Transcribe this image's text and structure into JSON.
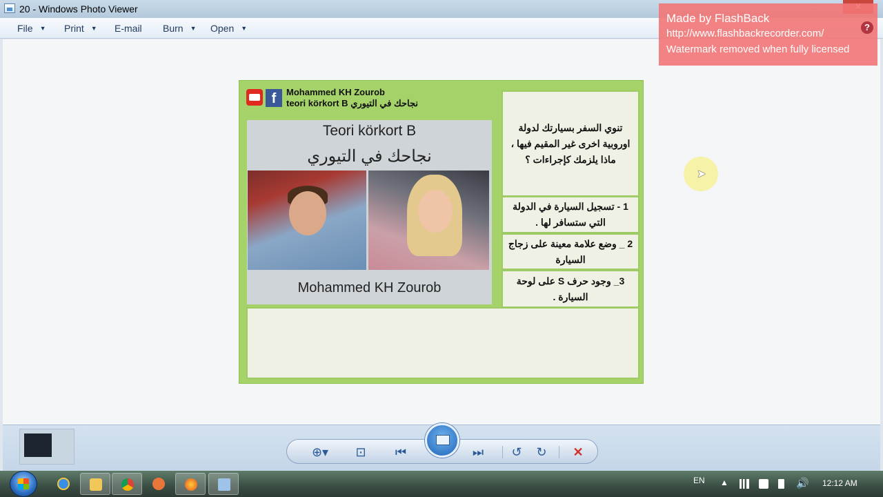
{
  "window": {
    "title": "20 - Windows Photo Viewer",
    "controls": {
      "minimize": "—",
      "maximize": "□",
      "close": "✕"
    }
  },
  "menu": {
    "items": [
      {
        "label": "File",
        "has_dropdown": true
      },
      {
        "label": "Print",
        "has_dropdown": true
      },
      {
        "label": "E-mail",
        "has_dropdown": false
      },
      {
        "label": "Burn",
        "has_dropdown": true
      },
      {
        "label": "Open",
        "has_dropdown": true
      }
    ]
  },
  "slide": {
    "brand_name": "Mohammed KH Zourob",
    "brand_sub": "teori körkort B نجاحك في التيوري",
    "poster": {
      "title": "Teori körkort B",
      "arabic_title": "نجاحك في التيوري",
      "name": "Mohammed KH Zourob"
    },
    "question": "تنوي السفر بسيارتك لدولة اوروبية اخرى غير المقيم فيها ، ماذا يلزمك كإجراءات ؟",
    "options": [
      "1 - تسجيل السيارة في الدولة التي ستسافر لها .",
      "2 _ وضع علامة معينة على زجاج السيارة",
      "3_ وجود حرف S على لوحة السيارة ."
    ]
  },
  "watermark": {
    "title": "Made by FlashBack",
    "url": "http://www.flashbackrecorder.com/",
    "note": "Watermark removed when fully licensed",
    "help": "?"
  },
  "taskbar": {
    "language": "EN",
    "time": "12:12 AM",
    "apps": [
      "start-orb",
      "ie-icon",
      "explorer-icon",
      "chrome-icon",
      "media-player-icon",
      "firefox-icon",
      "photo-viewer-icon"
    ]
  },
  "colors": {
    "slide_bg": "#a5d36a",
    "watermark_bg": "#f27676",
    "delete_red": "#d0312d"
  }
}
